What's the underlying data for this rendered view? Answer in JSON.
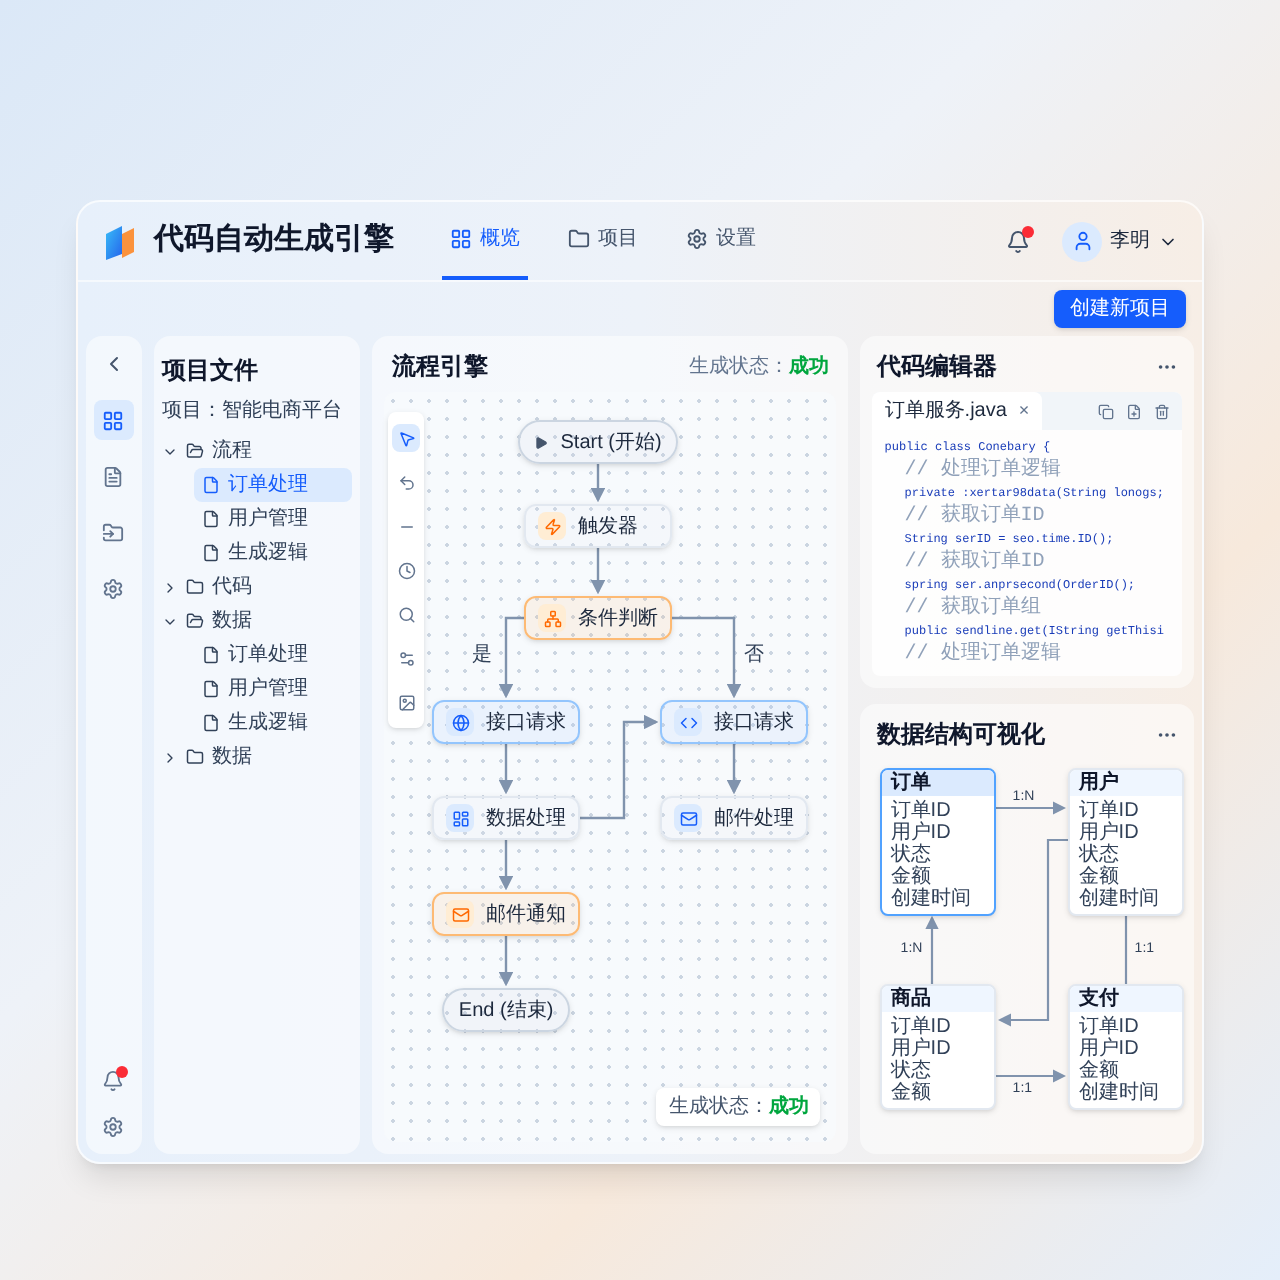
{
  "app": {
    "title": "代码自动生成引擎"
  },
  "nav_tabs": [
    {
      "label": "概览",
      "selected": true
    },
    {
      "label": "项目",
      "selected": false
    },
    {
      "label": "设置",
      "selected": false
    }
  ],
  "user": {
    "name": "李明",
    "unread": true
  },
  "create_button": "创建新项目",
  "rail": {
    "items": [
      {
        "selected": true
      },
      {
        "selected": false
      },
      {
        "selected": false
      },
      {
        "selected": false
      }
    ],
    "unread": true
  },
  "files": {
    "title": "项目文件",
    "project_label": "项目：",
    "project_name": "智能电商平台",
    "tree": [
      {
        "label": "流程",
        "expanded": true,
        "children": [
          {
            "label": "订单处理",
            "selected": true
          },
          {
            "label": "用户管理",
            "selected": false
          },
          {
            "label": "生成逻辑",
            "selected": false
          }
        ]
      },
      {
        "label": "代码",
        "expanded": false
      },
      {
        "label": "数据",
        "expanded": true,
        "children": [
          {
            "label": "订单处理",
            "selected": false
          },
          {
            "label": "用户管理",
            "selected": false
          },
          {
            "label": "生成逻辑",
            "selected": false
          }
        ]
      },
      {
        "label": "数据",
        "expanded": false
      }
    ]
  },
  "flow": {
    "title": "流程引擎",
    "status_label": "生成状态：",
    "status_value": "成功",
    "nodes": [
      {
        "kind": "start",
        "label": "Start (开始)",
        "color": "#cbd5e1"
      },
      {
        "kind": "trigger",
        "label": "触发器",
        "color": "#e2e8f0"
      },
      {
        "kind": "condition",
        "label": "条件判断",
        "color": "#fdba74"
      },
      {
        "kind": "globe",
        "label": "接口请求",
        "color": "#93c5fd"
      },
      {
        "kind": "code",
        "label": "接口请求",
        "color": "#93c5fd"
      },
      {
        "kind": "data",
        "label": "数据处理",
        "color": "#e2e8f0"
      },
      {
        "kind": "mail",
        "label": "邮件处理",
        "color": "#e2e8f0"
      },
      {
        "kind": "mail",
        "label": "邮件通知",
        "color": "#fdba74"
      },
      {
        "kind": "end",
        "label": "End (结束)",
        "color": "#cbd5e1"
      }
    ],
    "branch_labels": [
      "是",
      "否"
    ],
    "badge_label": "生成状态：",
    "badge_value": "成功"
  },
  "editor": {
    "title": "代码编辑器",
    "tab": "订单服务.java",
    "close": "×",
    "lines": [
      {
        "kind": "code",
        "text": "public class Conebary {"
      },
      {
        "kind": "comment",
        "text": "// 处理订单逻辑"
      },
      {
        "kind": "code",
        "text": "private :xertar98data(String lonogs;"
      },
      {
        "kind": "comment",
        "text": "// 获取订单ID"
      },
      {
        "kind": "code",
        "text": "String serID = seo.time.ID();"
      },
      {
        "kind": "comment",
        "text": "// 获取订单ID"
      },
      {
        "kind": "code",
        "text": "spring ser.anprsecond(OrderID();"
      },
      {
        "kind": "comment",
        "text": "// 获取订单组"
      },
      {
        "kind": "code",
        "text": "public sendline.get(IString getThisi"
      },
      {
        "kind": "comment",
        "text": "// 处理订单逻辑"
      }
    ]
  },
  "schema": {
    "title": "数据结构可视化",
    "entities": [
      {
        "name": "订单",
        "selected": true,
        "fields": [
          "订单ID",
          "用户ID",
          "状态",
          "金额",
          "创建时间"
        ]
      },
      {
        "name": "用户",
        "selected": false,
        "fields": [
          "订单ID",
          "用户ID",
          "状态",
          "金额",
          "创建时间"
        ]
      },
      {
        "name": "商品",
        "selected": false,
        "fields": [
          "订单ID",
          "用户ID",
          "状态",
          "金额"
        ]
      },
      {
        "name": "支付",
        "selected": false,
        "fields": [
          "订单ID",
          "用户ID",
          "金额",
          "创建时间"
        ]
      }
    ],
    "relations": [
      {
        "label": "1:N"
      },
      {
        "label": "1:N"
      },
      {
        "label": "1:1"
      },
      {
        "label": "1:1"
      }
    ]
  }
}
